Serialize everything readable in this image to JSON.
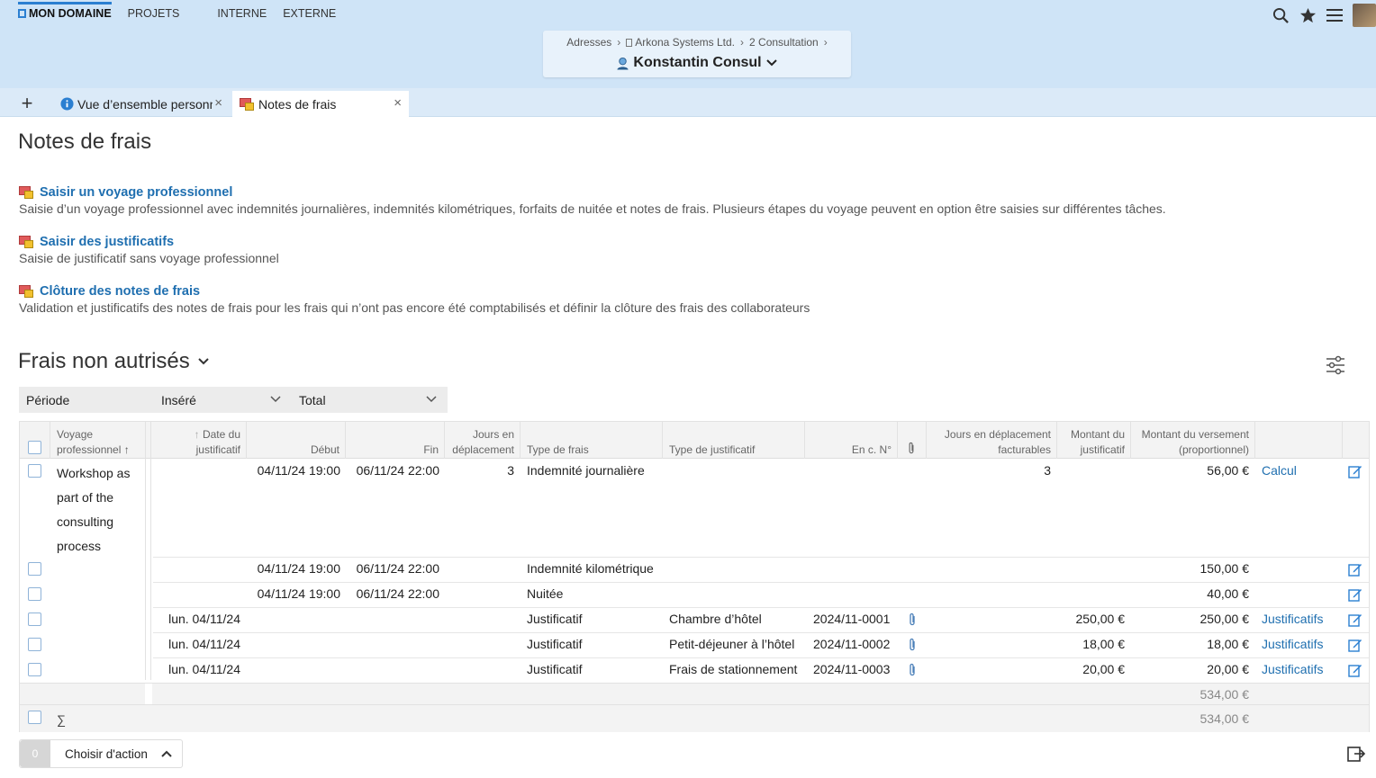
{
  "topnav": {
    "items": [
      "MON DOMAINE",
      "PROJETS",
      "INTERNE",
      "EXTERNE"
    ]
  },
  "header": {
    "breadcrumbs": [
      "Adresses",
      "Arkona Systems Ltd.",
      "2 Consultation"
    ],
    "separator": "›",
    "person": "Konstantin Consul"
  },
  "tabs": {
    "add": "+",
    "items": [
      {
        "label": "Vue d’ensemble personnelle",
        "close": "×"
      },
      {
        "label": "Notes de frais",
        "close": "×"
      }
    ]
  },
  "page": {
    "title": "Notes de frais"
  },
  "actions": [
    {
      "title": "Saisir un voyage professionnel",
      "desc": "Saisie d’un voyage professionnel avec indemnités journalières, indemnités kilométriques, forfaits de nuitée et notes de frais. Plusieurs étapes du voyage peuvent en option être saisies sur différentes tâches."
    },
    {
      "title": "Saisir des justificatifs",
      "desc": "Saisie de justificatif sans voyage professionnel"
    },
    {
      "title": "Clôture des notes de frais",
      "desc": "Validation et justificatifs des notes de frais pour les frais qui n’ont pas encore été comptabilisés et définir la clôture des frais des collaborateurs"
    }
  ],
  "section": {
    "title": "Frais non autrisés"
  },
  "filters": {
    "periode": "Période",
    "insere": "Inséré",
    "total": "Total"
  },
  "table": {
    "headers": {
      "voyage_1": "Voyage",
      "voyage_2": "professionnel",
      "date_1": "Date du",
      "date_2": "justificatif",
      "debut": "Début",
      "fin": "Fin",
      "jours_1": "Jours en",
      "jours_2": "déplacement",
      "type_frais": "Type de frais",
      "type_just": "Type de justificatif",
      "enc": "En c. N°",
      "jours_fact_1": "Jours en déplacement",
      "jours_fact_2": "facturables",
      "montant_just_1": "Montant du",
      "montant_just_2": "justificatif",
      "montant_vers_1": "Montant du versement",
      "montant_vers_2": "(proportionnel)"
    },
    "voyage_lines": [
      "Workshop as",
      "part of the",
      "consulting",
      "process"
    ],
    "rows": [
      {
        "date": "",
        "debut": "04/11/24 19:00",
        "fin": "06/11/24 22:00",
        "jours": "3",
        "type_frais": "Indemnité journalière",
        "type_just": "",
        "enc": "",
        "jours_fact": "3",
        "montant_just": "",
        "montant_vers": "56,00 €",
        "link": "Calcul"
      },
      {
        "date": "",
        "debut": "04/11/24 19:00",
        "fin": "06/11/24 22:00",
        "jours": "",
        "type_frais": "Indemnité kilométrique",
        "type_just": "",
        "enc": "",
        "jours_fact": "",
        "montant_just": "",
        "montant_vers": "150,00 €",
        "link": ""
      },
      {
        "date": "",
        "debut": "04/11/24 19:00",
        "fin": "06/11/24 22:00",
        "jours": "",
        "type_frais": "Nuitée",
        "type_just": "",
        "enc": "",
        "jours_fact": "",
        "montant_just": "",
        "montant_vers": "40,00 €",
        "link": ""
      },
      {
        "date": "lun. 04/11/24",
        "debut": "",
        "fin": "",
        "jours": "",
        "type_frais": "Justificatif",
        "type_just": "Chambre d’hôtel",
        "enc": "2024/11-0001",
        "jours_fact": "",
        "montant_just": "250,00 €",
        "montant_vers": "250,00 €",
        "link": "Justificatifs"
      },
      {
        "date": "lun. 04/11/24",
        "debut": "",
        "fin": "",
        "jours": "",
        "type_frais": "Justificatif",
        "type_just": "Petit-déjeuner à l’hôtel",
        "enc": "2024/11-0002",
        "jours_fact": "",
        "montant_just": "18,00 €",
        "montant_vers": "18,00 €",
        "link": "Justificatifs"
      },
      {
        "date": "lun. 04/11/24",
        "debut": "",
        "fin": "",
        "jours": "",
        "type_frais": "Justificatif",
        "type_just": "Frais de stationnement",
        "enc": "2024/11-0003",
        "jours_fact": "",
        "montant_just": "20,00 €",
        "montant_vers": "20,00 €",
        "link": "Justificatifs"
      }
    ],
    "subtotal": "534,00 €",
    "sigma": "∑",
    "total": "534,00 €"
  },
  "footer": {
    "count": "0",
    "action_label": "Choisir d'action"
  }
}
